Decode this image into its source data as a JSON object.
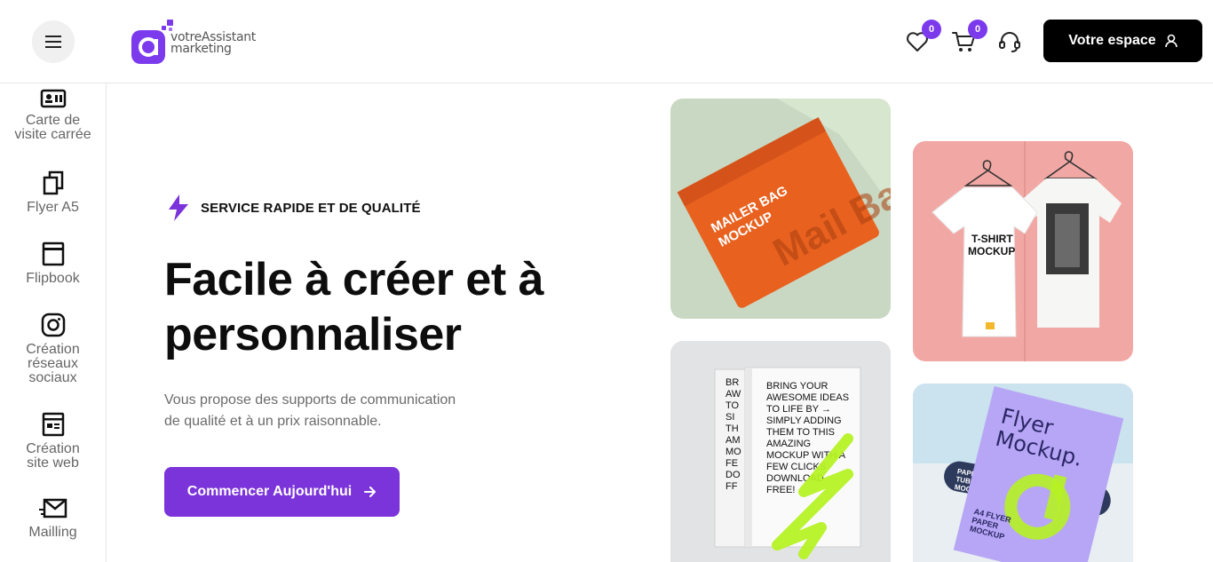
{
  "header": {
    "logo_line1": "votreAssistant",
    "logo_line2": "marketing",
    "wishlist_count": "0",
    "cart_count": "0",
    "account_button": "Votre espace"
  },
  "sidebar": {
    "items": [
      {
        "label_line1": "Carte de",
        "label_line2": "visite carrée",
        "icon": "id-card-icon"
      },
      {
        "label_line1": "Flyer A5",
        "icon": "copy-pages-icon"
      },
      {
        "label_line1": "Flipbook",
        "icon": "book-icon"
      },
      {
        "label_line1": "Création",
        "label_line2": "réseaux",
        "label_line3": "sociaux",
        "icon": "instagram-icon"
      },
      {
        "label_line1": "Création",
        "label_line2": "site web",
        "icon": "newspaper-icon"
      },
      {
        "label_line1": "Mailling",
        "icon": "envelope-icon"
      }
    ]
  },
  "hero": {
    "tagline": "SERVICE RAPIDE ET DE QUALITÉ",
    "title_line1": "Facile à créer et à",
    "title_line2": "personnaliser",
    "desc_line1": "Vous propose des supports de communication",
    "desc_line2": "de qualité et à un prix raisonnable.",
    "cta": "Commencer Aujourd'hui"
  },
  "cards": {
    "mailer": {
      "line1": "MAILER BAG",
      "line2": "MOCKUP",
      "big": "Mail Back"
    },
    "tshirt": {
      "line1": "T-SHIRT",
      "line2": "MOCKUP"
    },
    "book": {
      "l1": "BRING YOUR",
      "l2": "AWESOME IDEAS",
      "l3": "TO LIFE BY →",
      "l4": "SIMPLY ADDING",
      "l5": "THEM TO THIS",
      "l6": "AMAZING",
      "l7": "MOCKUP WITH A",
      "l8": "FEW CLICKS",
      "l9": "DOWNLOAD",
      "l10": "FREE!"
    },
    "flyer": {
      "title1": "Flyer",
      "title2": "Mockup.",
      "tube1": "PAPER",
      "tube2": "TUBE",
      "tube3": "MOCKUP",
      "sub1": "A4 FLYER",
      "sub2": "PAPER",
      "sub3": "MOCKUP"
    }
  },
  "colors": {
    "brand": "#7b34d9",
    "badge": "#7c3aed",
    "dark": "#000000"
  }
}
